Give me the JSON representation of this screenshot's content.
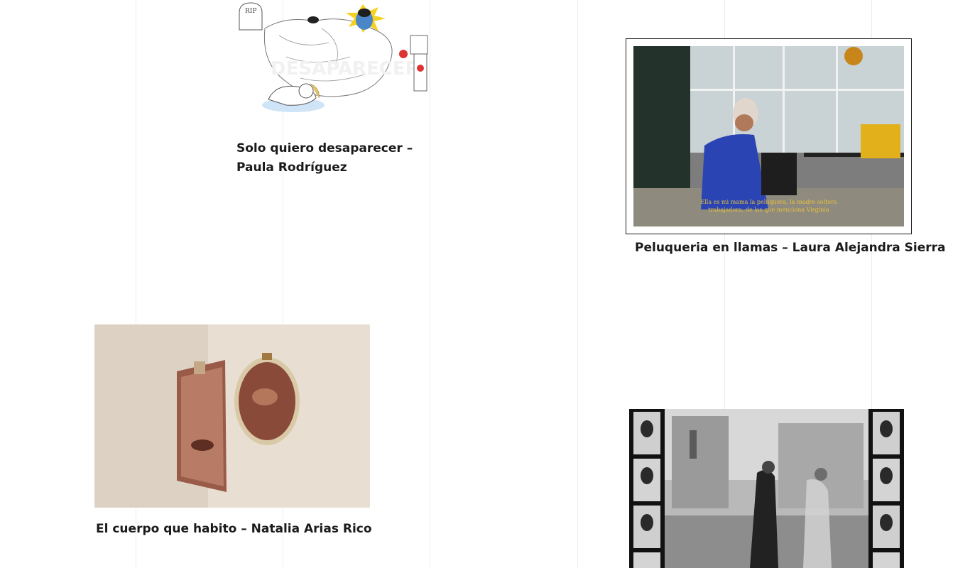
{
  "works": [
    {
      "id": "solo-quiero-desaparecer",
      "caption": "Solo quiero desaparecer – Paula Rodríguez",
      "image_text": [
        "RIP"
      ]
    },
    {
      "id": "peluqueria-en-llamas",
      "caption": "Peluqueria en llamas – Laura Alejandra Sierra",
      "subtitle_line1": "Ella es mi mama la peluquera, la madre soltera",
      "subtitle_line2": "trabajadora, de las que menciona Virginia"
    },
    {
      "id": "el-cuerpo-que-habito",
      "caption": "El cuerpo que habito – Natalia Arias Rico"
    },
    {
      "id": "film-strip-work"
    }
  ],
  "colors": {
    "text": "#1a1a1a",
    "grid": "#ececec",
    "subtitle": "#e8c23a"
  }
}
